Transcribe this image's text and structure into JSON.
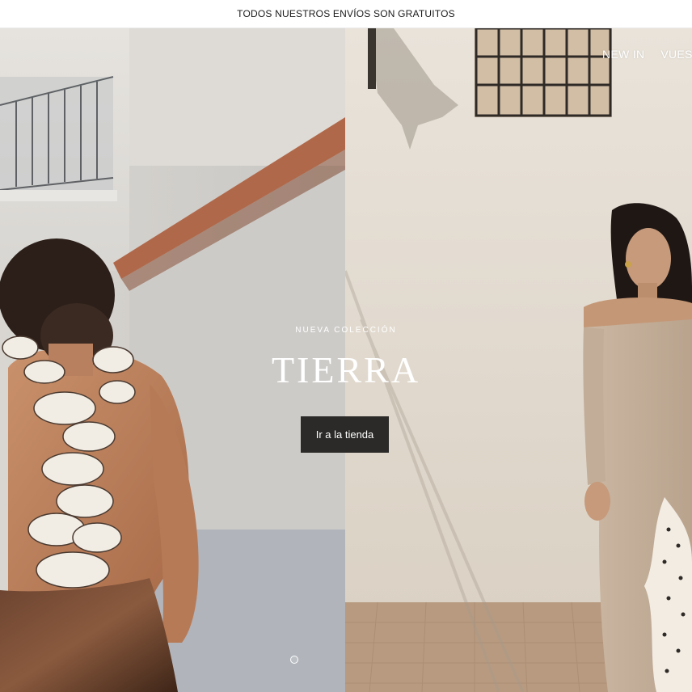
{
  "announcement": {
    "text": "TODOS NUESTROS ENVÍOS SON GRATUITOS"
  },
  "nav": {
    "items": [
      {
        "label": "NEW IN"
      },
      {
        "label": "VUEST"
      }
    ]
  },
  "hero": {
    "eyebrow": "NUEVA COLECCIÓN",
    "title": "TIERRA",
    "cta_label": "Ir a la tienda",
    "slides_active": 1
  },
  "colors": {
    "button_bg": "#2b2a28",
    "overlay_text": "#ffffff"
  }
}
